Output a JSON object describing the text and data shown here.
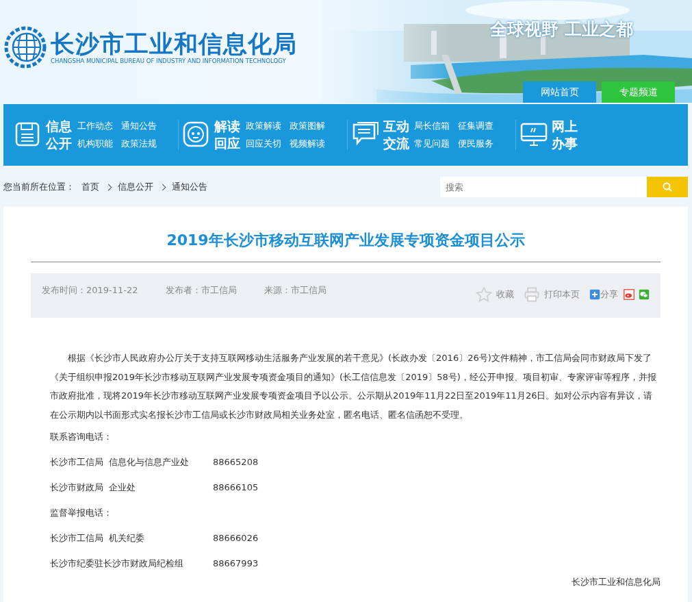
{
  "header": {
    "title": "长沙市工业和信息化局",
    "subtitle": "CHANGSHA MUNICIPAL BUREAU OF INDUSTRY AND INFORMATION TECHNOLOGY",
    "slogan": "全球视野 工业之都",
    "tabs": [
      {
        "label": "网站首页",
        "color": "#1a98dc"
      },
      {
        "label": "专题频道",
        "color": "#2ec43c"
      }
    ]
  },
  "nav": [
    {
      "kind": "disk",
      "title": "信息公开",
      "links": [
        "工作动态",
        "通知公告",
        "机构职能",
        "政策法规"
      ]
    },
    {
      "kind": "face",
      "title": "解读回应",
      "links": [
        "政策解读",
        "政策图解",
        "回应关切",
        "视频解读"
      ]
    },
    {
      "kind": "chat",
      "title": "互动交流",
      "links": [
        "局长信箱",
        "征集调查",
        "常见问题",
        "便民服务"
      ]
    },
    {
      "kind": "monitor",
      "title": "网上办事"
    }
  ],
  "breadcrumb": {
    "label": "您当前所在位置：",
    "items": [
      "首页",
      "信息公开",
      "通知公告"
    ]
  },
  "search": {
    "placeholder": "搜索"
  },
  "article": {
    "title": "2019年长沙市移动互联网产业发展专项资金项目公示",
    "meta": [
      "发布时间：2019-11-22",
      "发布者：市工信局",
      "来源：市工信局"
    ],
    "actions": {
      "favorite": "收藏",
      "print": "打印本页",
      "share": "分享"
    },
    "body": "根据《长沙市人民政府办公厅关于支持互联网移动生活服务产业发展的若干意见》(长政办发〔2016〕26号)文件精神，市工信局会同市财政局下发了《关于组织申报2019年长沙市移动互联网产业发展专项资金项目的通知》(长工信信息发〔2019〕58号)，经公开申报、项目初审、专家评审等程序，并报市政府批准，现将2019年长沙市移动互联网产业发展专项资金项目予以公示。公示期从2019年11月22日至2019年11月26日。如对公示内容有异议，请在公示期内以书面形式实名报长沙市工信局或长沙市财政局相关业务处室，匿名电话、匿名信函恕不受理。",
    "contacts": [
      {
        "heading": "联系咨询电话：",
        "rows": [
          {
            "name": "长沙市工信局  信息化与信息产业处",
            "phone": "88665208"
          },
          {
            "name": "长沙市财政局  企业处",
            "phone": "88666105"
          }
        ]
      },
      {
        "heading": "监督举报电话：",
        "rows": [
          {
            "name": "长沙市工信局  机关纪委",
            "phone": "88666026"
          },
          {
            "name": "长沙市纪委驻长沙市财政局纪检组",
            "phone": "88667993"
          }
        ]
      }
    ],
    "signature": "长沙市工业和信息化局"
  }
}
